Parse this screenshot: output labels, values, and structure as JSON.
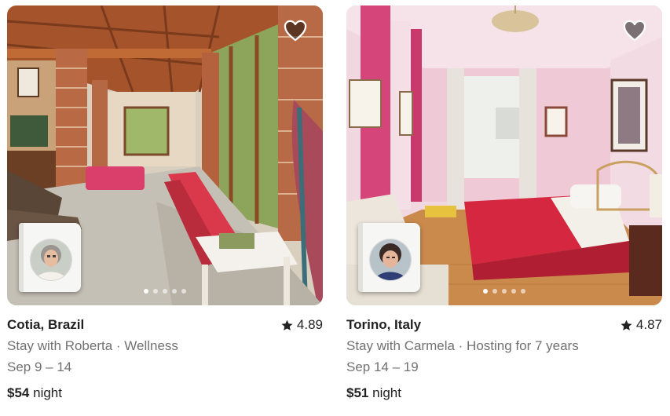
{
  "listings": [
    {
      "location": "Cotia, Brazil",
      "rating": "4.89",
      "subtitle": "Stay with Roberta · Wellness",
      "dates": "Sep 9 – 14",
      "price": "$54",
      "price_unit": "night",
      "photo_count": 5,
      "active_photo": 1,
      "favorited": false
    },
    {
      "location": "Torino, Italy",
      "rating": "4.87",
      "subtitle": "Stay with Carmela · Hosting for 7 years",
      "dates": "Sep 14 – 19",
      "price": "$51",
      "price_unit": "night",
      "photo_count": 5,
      "active_photo": 1,
      "favorited": false
    }
  ],
  "icons": {
    "favorite": "heart-outline-icon",
    "rating": "star-icon"
  },
  "colors": {
    "text_primary": "#222222",
    "text_secondary": "#717171"
  }
}
